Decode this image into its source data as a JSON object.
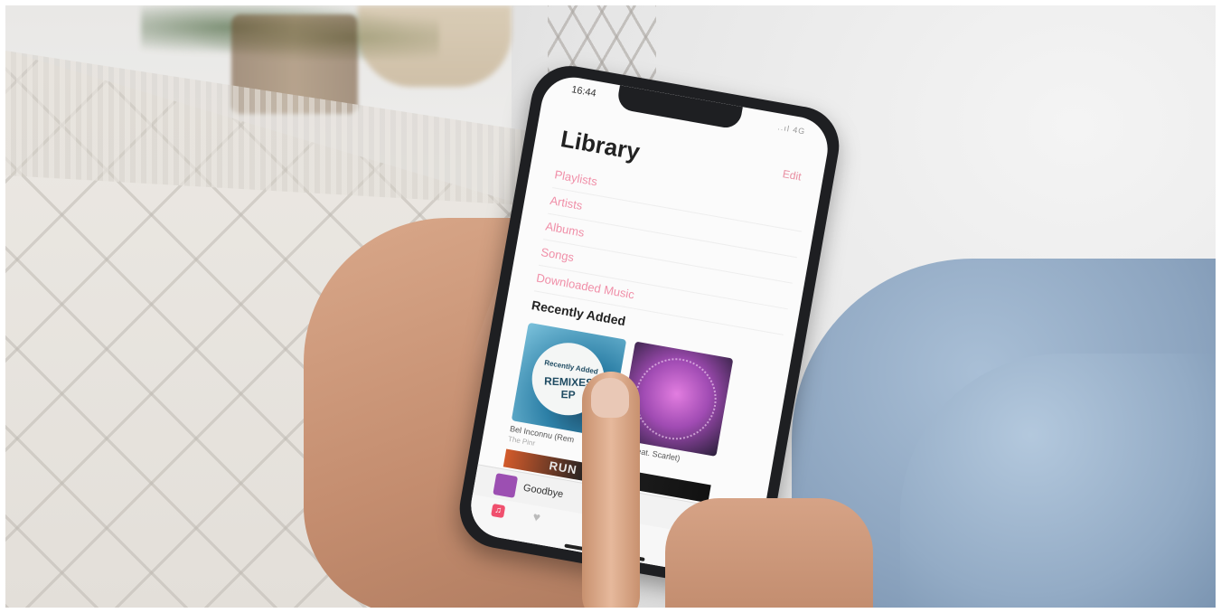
{
  "phone": {
    "status_time": "16:44",
    "status_icons": "..ıl 4G",
    "edit_label": "Edit",
    "title": "Library",
    "menu_items": [
      "Playlists",
      "Artists",
      "Albums",
      "Songs",
      "Downloaded Music"
    ],
    "recently_added_label": "Recently Added",
    "albums": [
      {
        "cover_line1": "Recently Added",
        "cover_line2": "REMIXES EP",
        "caption": "Bel Inconnu (Rem",
        "subcaption": "The Pinr"
      },
      {
        "caption": "bye (feat. Scarlet)"
      }
    ],
    "strip_text": "RUN",
    "now_playing": "Goodbye",
    "play_icon": "▶",
    "next_icon": "▶▶",
    "tab_library_icon": "♫",
    "tab_heart_icon": "♥"
  },
  "colors": {
    "accent": "#f08fa8",
    "phone_body": "#1e1f22",
    "jeans": "#8ca4bf"
  }
}
